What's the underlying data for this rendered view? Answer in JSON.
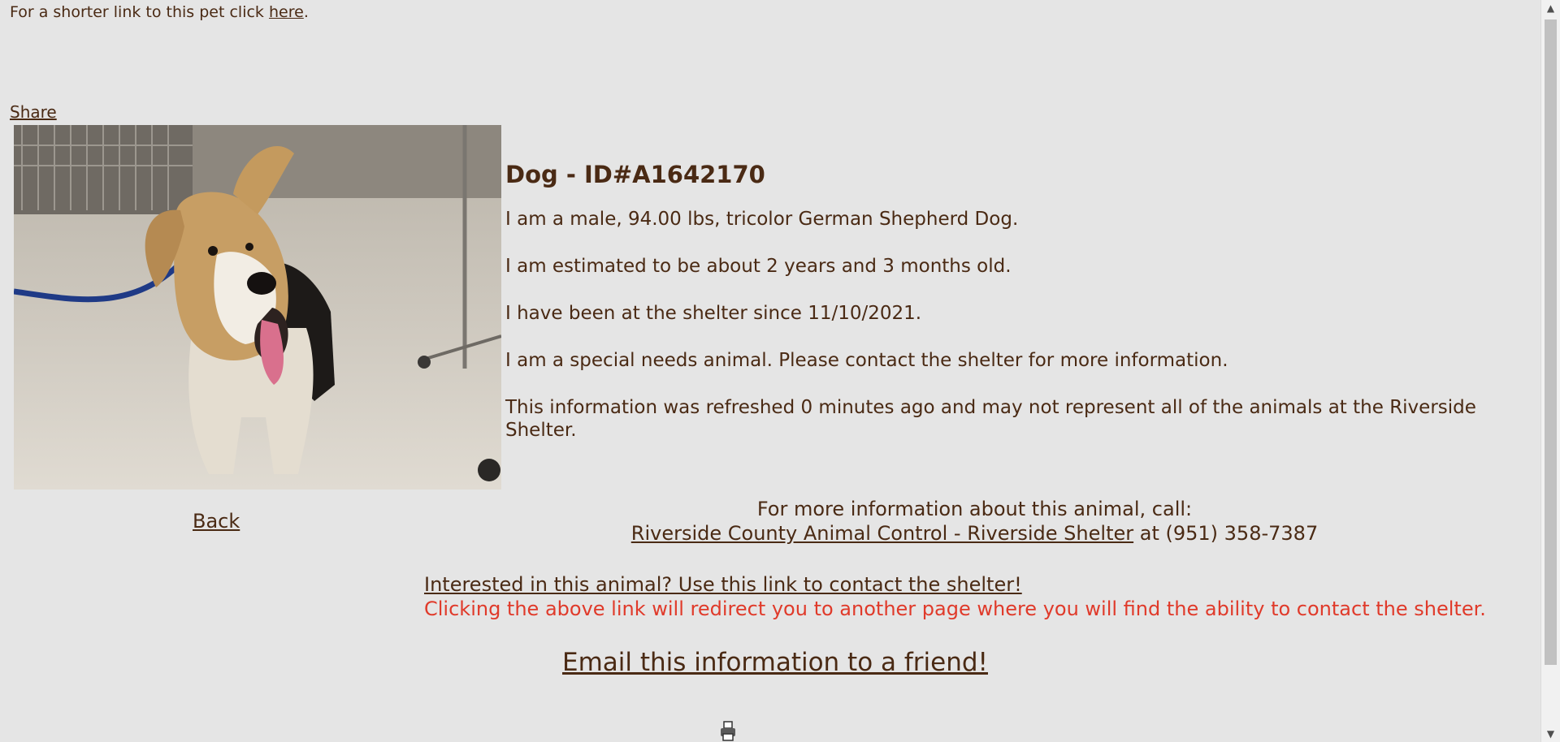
{
  "short_link": {
    "prefix": "For a shorter link to this pet click ",
    "link": "here",
    "suffix": "."
  },
  "share": "Share",
  "animal": {
    "title": "Dog - ID#A1642170",
    "description": "I am a male, 94.00 lbs, tricolor German Shepherd Dog.",
    "age": "I am estimated to be about 2 years and 3 months old.",
    "since": "I have been at the shelter since 11/10/2021.",
    "special": "I am a special needs animal. Please contact the shelter for more information.",
    "refresh": "This information was refreshed 0 minutes ago and may not represent all of the animals at the Riverside Shelter."
  },
  "back": "Back",
  "call": {
    "intro": "For more information about this animal, call:",
    "shelter_link": "Riverside County Animal Control - Riverside Shelter",
    "phone": "at (951) 358-7387"
  },
  "interest": {
    "link": "Interested in this animal? Use this link to contact the shelter!",
    "warning": "Clicking the above link will redirect you to another page where you will find the ability to contact the shelter."
  },
  "email": "Email this information to a friend!",
  "icons": {
    "printer": "printer-icon"
  },
  "colors": {
    "background": "#e5e5e5",
    "text": "#4a2a14",
    "warning": "#e03a2a"
  }
}
